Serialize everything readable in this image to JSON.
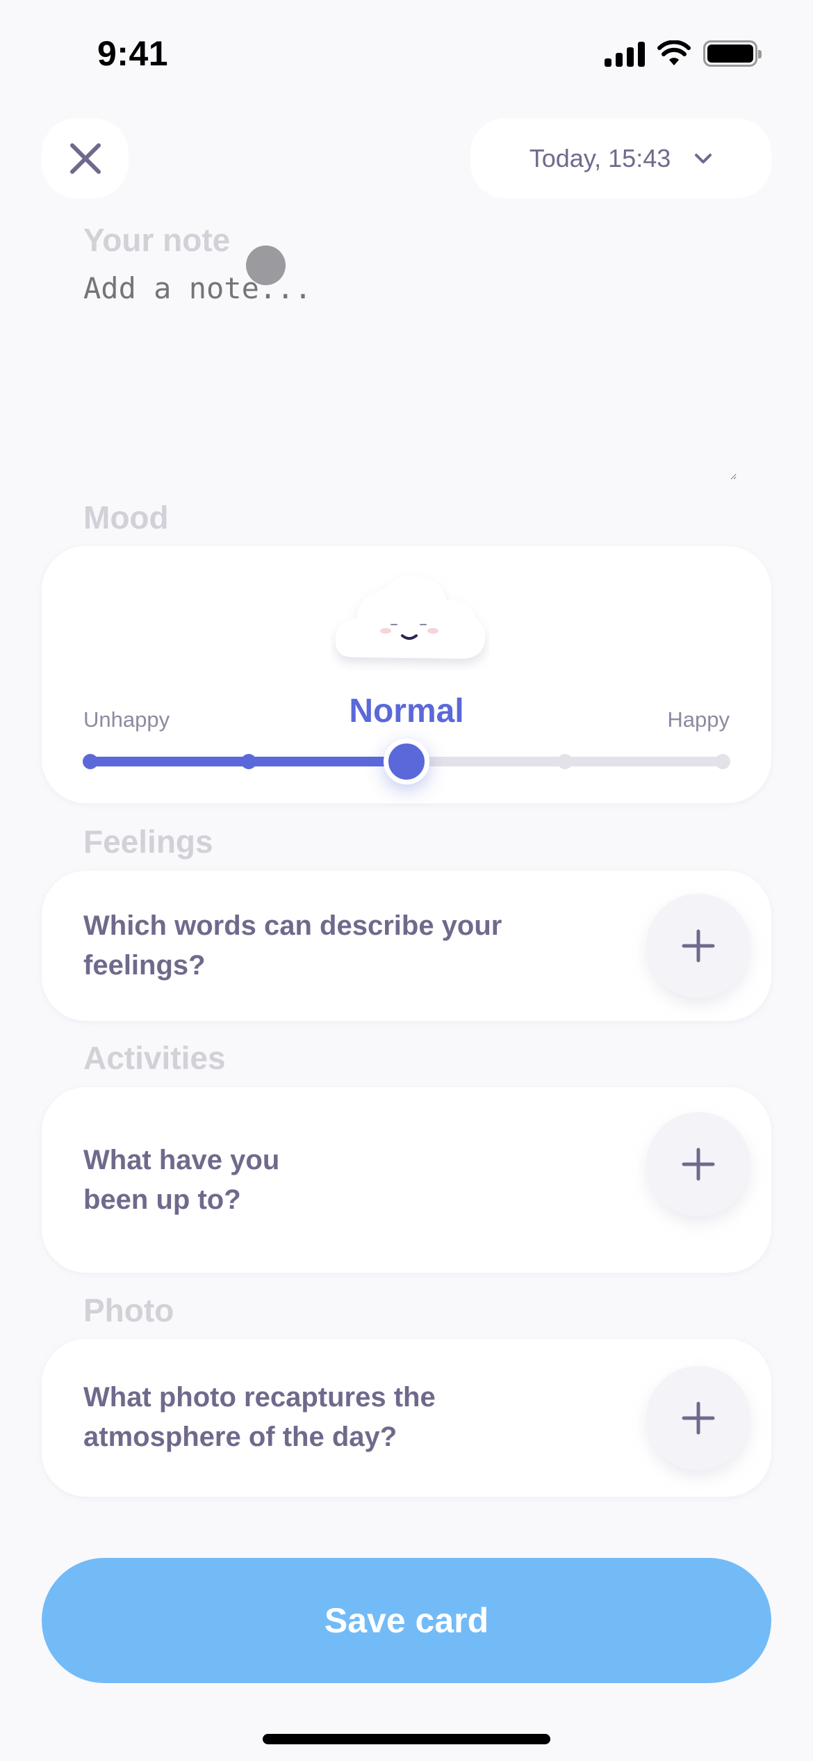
{
  "status_bar": {
    "time": "9:41"
  },
  "header": {
    "close_icon": "close-icon",
    "date_label": "Today, 15:43",
    "date_icon": "chevron-down-icon"
  },
  "note": {
    "label": "Your note",
    "placeholder": "Add a note...",
    "value": ""
  },
  "mood": {
    "label": "Mood",
    "min_label": "Unhappy",
    "max_label": "Happy",
    "current_label": "Normal",
    "steps": 5,
    "selected_index": 2,
    "accent_color": "#5B68D9",
    "inactive_color": "#E3E2E8"
  },
  "feelings": {
    "label": "Feelings",
    "prompt": "Which words can describe your feelings?",
    "add_icon": "plus-icon"
  },
  "activities": {
    "label": "Activities",
    "prompt": "What have you been up to?",
    "add_icon": "plus-icon"
  },
  "photo": {
    "label": "Photo",
    "prompt": "What photo recaptures the atmosphere of the day?",
    "add_icon": "plus-icon"
  },
  "save_button": {
    "label": "Save card",
    "color": "#72BBF7"
  }
}
